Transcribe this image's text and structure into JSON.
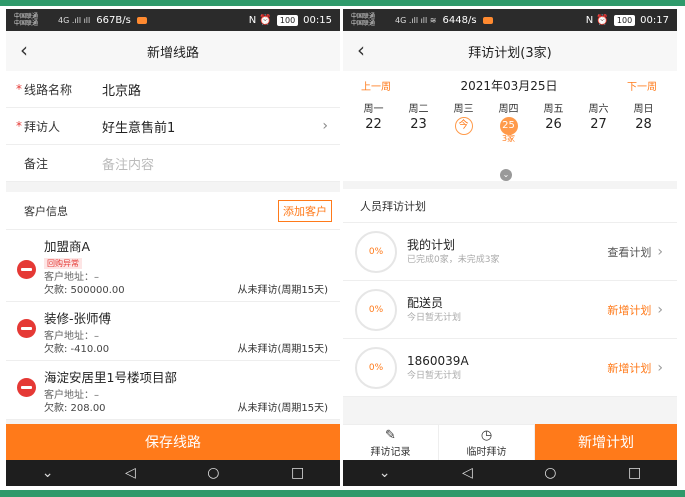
{
  "left": {
    "status": {
      "carrier_line1": "中国联通",
      "carrier_line2": "中国联通",
      "signal": "4G .ıll ıll",
      "speed": "667B/s",
      "icons": "N ⏰",
      "battery": "100",
      "time": "00:15"
    },
    "nav": {
      "back_glyph": "‹",
      "title": "新增线路"
    },
    "form": {
      "route_name_label": "线路名称",
      "route_name_value": "北京路",
      "visitor_label": "拜访人",
      "visitor_value": "好生意售前1",
      "remark_label": "备注",
      "remark_placeholder": "备注内容",
      "required_mark": "*",
      "chevron": "›"
    },
    "customers": {
      "section_title": "客户信息",
      "add_button": "添加客户",
      "items": [
        {
          "name": "加盟商A",
          "tag": "回购异常",
          "address": "客户地址：–",
          "debt": "欠款: 500000.00",
          "visit": "从未拜访(周期15天)"
        },
        {
          "name": "装修-张师傅",
          "tag": "",
          "address": "客户地址：–",
          "debt": "欠款: -410.00",
          "visit": "从未拜访(周期15天)"
        },
        {
          "name": "海淀安居里1号楼项目部",
          "tag": "",
          "address": "客户地址：–",
          "debt": "欠款: 208.00",
          "visit": "从未拜访(周期15天)"
        }
      ]
    },
    "save_button": "保存线路"
  },
  "right": {
    "status": {
      "carrier_line1": "中国联通",
      "carrier_line2": "中国联通",
      "signal": "4G .ıll ıll ≋",
      "speed": "6448/s",
      "icons": "N ⏰",
      "battery": "100",
      "time": "00:17"
    },
    "nav": {
      "back_glyph": "‹",
      "title": "拜访计划(3家)"
    },
    "calendar": {
      "prev": "上一周",
      "next": "下一周",
      "date": "2021年03月25日",
      "days": [
        {
          "weekday": "周一",
          "date": "22"
        },
        {
          "weekday": "周二",
          "date": "23"
        },
        {
          "weekday": "周三",
          "date": "今",
          "today": true
        },
        {
          "weekday": "周四",
          "date": "25",
          "selected": true,
          "sub": "3家"
        },
        {
          "weekday": "周五",
          "date": "26"
        },
        {
          "weekday": "周六",
          "date": "27"
        },
        {
          "weekday": "周日",
          "date": "28"
        }
      ],
      "expand_glyph": "⌄"
    },
    "plans_title": "人员拜访计划",
    "plans": [
      {
        "percent": "0%",
        "name": "我的计划",
        "sub": "已完成0家，未完成3家",
        "action": "查看计划",
        "style": "grey"
      },
      {
        "percent": "0%",
        "name": "配送员",
        "sub": "今日暂无计划",
        "action": "新增计划",
        "style": "orange"
      },
      {
        "percent": "0%",
        "name": "1860039A",
        "sub": "今日暂无计划",
        "action": "新增计划",
        "style": "orange"
      }
    ],
    "bottom": {
      "visit_record": "拜访记录",
      "temp_visit": "临时拜访",
      "new_plan": "新增计划"
    }
  },
  "sysnav": {
    "back": "◁",
    "home": "○",
    "recent": "□",
    "down": "⌄"
  },
  "colors": {
    "accent": "#ff7a1a",
    "danger": "#e53935",
    "band": "#2f9a6b"
  }
}
